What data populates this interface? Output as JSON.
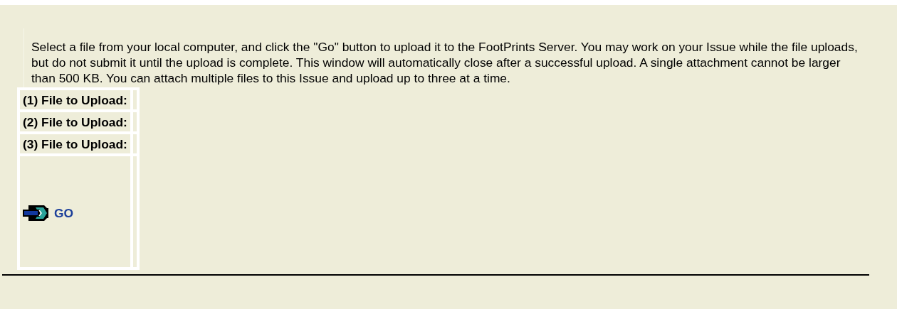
{
  "instructions": "Select a file from your local computer, and click the \"Go\" button to upload it to the FootPrints Server. You may work on your Issue while the file uploads, but do not submit it until the upload is complete. This window will automatically close after a successful upload. A single attachment cannot be larger than 500 KB. You can attach multiple files to this Issue and upload up to three at a time.",
  "upload_rows": [
    {
      "label": "(1) File to Upload:"
    },
    {
      "label": "(2) File to Upload:"
    },
    {
      "label": "(3) File to Upload:"
    }
  ],
  "go_button": {
    "label": "GO"
  }
}
